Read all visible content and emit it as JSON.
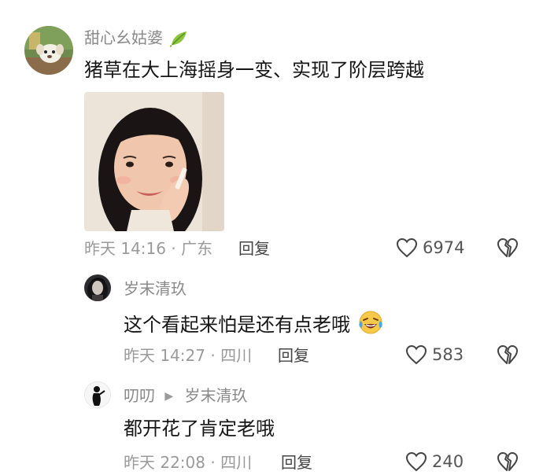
{
  "comments": [
    {
      "username": "甜心幺姑婆",
      "username_icon": "leaf-icon",
      "text": "猪草在大上海摇身一变、实现了阶层跨越",
      "has_image": true,
      "time": "昨天 14:16",
      "location": "广东",
      "meta": "昨天 14:16 · 广东",
      "reply_label": "回复",
      "likes": "6974"
    },
    {
      "username": "岁末清玖",
      "text": "这个看起来怕是还有点老哦",
      "emoji": "crying-laughing-emoji",
      "time": "昨天 14:27",
      "location": "四川",
      "meta": "昨天 14:27 · 四川",
      "reply_label": "回复",
      "likes": "583"
    },
    {
      "username": "叨叨",
      "reply_to": "岁末清玖",
      "text": "都开花了肯定老哦",
      "time": "昨天 22:08",
      "location": "四川",
      "meta": "昨天 22:08 · 四川",
      "reply_label": "回复",
      "likes": "240"
    }
  ],
  "colors": {
    "username": "#8a8a8a",
    "text": "#161616",
    "meta": "#9a9a9a"
  }
}
